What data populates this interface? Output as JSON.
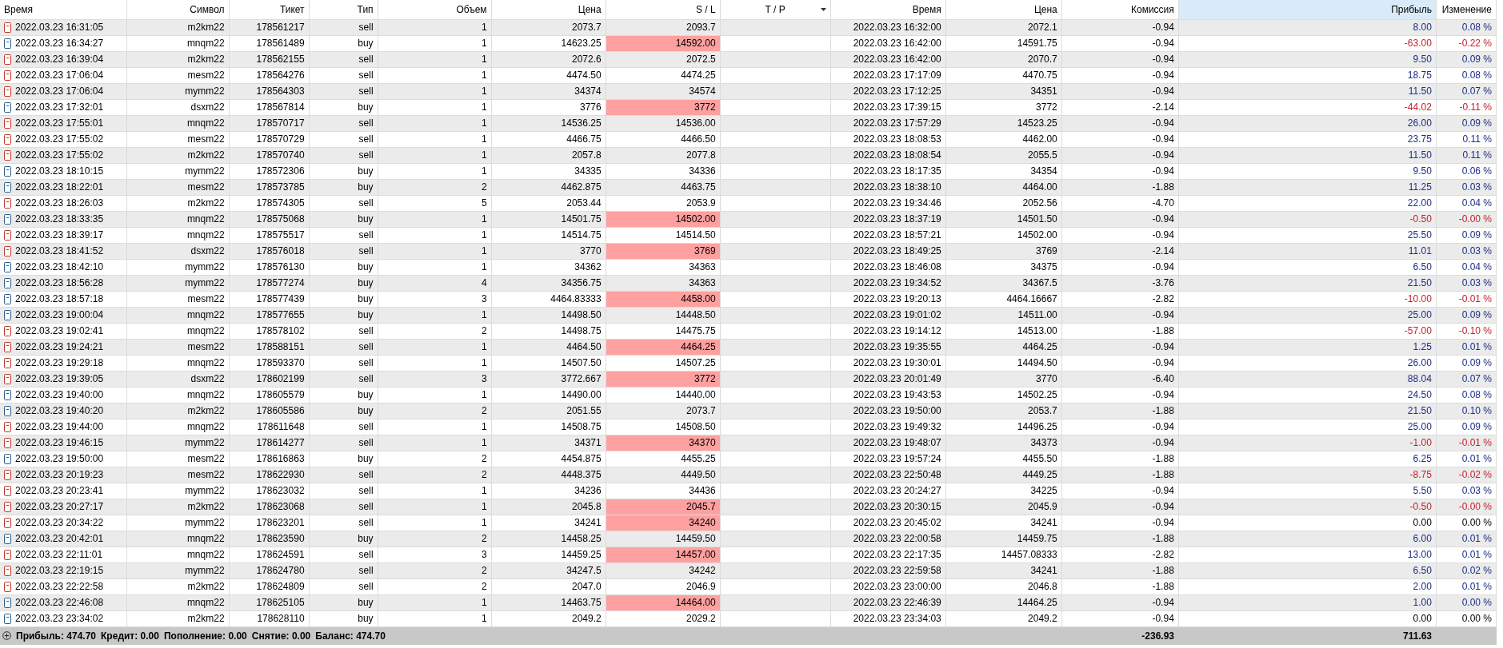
{
  "columns": [
    {
      "label": "Время",
      "highlighted": false,
      "sorted": false
    },
    {
      "label": "Символ",
      "highlighted": false,
      "sorted": false
    },
    {
      "label": "Тикет",
      "highlighted": false,
      "sorted": false
    },
    {
      "label": "Тип",
      "highlighted": false,
      "sorted": false
    },
    {
      "label": "Объем",
      "highlighted": false,
      "sorted": false
    },
    {
      "label": "Цена",
      "highlighted": false,
      "sorted": false
    },
    {
      "label": "S / L",
      "highlighted": false,
      "sorted": false
    },
    {
      "label": "T / P",
      "highlighted": false,
      "sorted": true
    },
    {
      "label": "Время",
      "highlighted": false,
      "sorted": false
    },
    {
      "label": "Цена",
      "highlighted": false,
      "sorted": false
    },
    {
      "label": "Комиссия",
      "highlighted": false,
      "sorted": false
    },
    {
      "label": "Прибыль",
      "highlighted": true,
      "sorted": false
    },
    {
      "label": "Изменение",
      "highlighted": false,
      "sorted": false
    }
  ],
  "rows": [
    {
      "kind": "sell",
      "open_time": "2022.03.23 16:31:05",
      "symbol": "m2km22",
      "ticket": "178561217",
      "type": "sell",
      "volume": "1",
      "price": "2073.7",
      "sl": "2093.7",
      "sl_hit": false,
      "close_time": "2022.03.23 16:32:00",
      "close_price": "2072.1",
      "commission": "-0.94",
      "profit": "8.00",
      "change": "0.08 %",
      "color": "#1a2f8a"
    },
    {
      "kind": "buy",
      "open_time": "2022.03.23 16:34:27",
      "symbol": "mnqm22",
      "ticket": "178561489",
      "type": "buy",
      "volume": "1",
      "price": "14623.25",
      "sl": "14592.00",
      "sl_hit": true,
      "close_time": "2022.03.23 16:42:00",
      "close_price": "14591.75",
      "commission": "-0.94",
      "profit": "-63.00",
      "change": "-0.22 %",
      "color": "#c8202a"
    },
    {
      "kind": "sell",
      "open_time": "2022.03.23 16:39:04",
      "symbol": "m2km22",
      "ticket": "178562155",
      "type": "sell",
      "volume": "1",
      "price": "2072.6",
      "sl": "2072.5",
      "sl_hit": false,
      "close_time": "2022.03.23 16:42:00",
      "close_price": "2070.7",
      "commission": "-0.94",
      "profit": "9.50",
      "change": "0.09 %",
      "color": "#1a2f8a"
    },
    {
      "kind": "sell",
      "open_time": "2022.03.23 17:06:04",
      "symbol": "mesm22",
      "ticket": "178564276",
      "type": "sell",
      "volume": "1",
      "price": "4474.50",
      "sl": "4474.25",
      "sl_hit": false,
      "close_time": "2022.03.23 17:17:09",
      "close_price": "4470.75",
      "commission": "-0.94",
      "profit": "18.75",
      "change": "0.08 %",
      "color": "#1a2f8a"
    },
    {
      "kind": "sell",
      "open_time": "2022.03.23 17:06:04",
      "symbol": "mymm22",
      "ticket": "178564303",
      "type": "sell",
      "volume": "1",
      "price": "34374",
      "sl": "34574",
      "sl_hit": false,
      "close_time": "2022.03.23 17:12:25",
      "close_price": "34351",
      "commission": "-0.94",
      "profit": "11.50",
      "change": "0.07 %",
      "color": "#1a2f8a"
    },
    {
      "kind": "buy",
      "open_time": "2022.03.23 17:32:01",
      "symbol": "dsxm22",
      "ticket": "178567814",
      "type": "buy",
      "volume": "1",
      "price": "3776",
      "sl": "3772",
      "sl_hit": true,
      "close_time": "2022.03.23 17:39:15",
      "close_price": "3772",
      "commission": "-2.14",
      "profit": "-44.02",
      "change": "-0.11 %",
      "color": "#c8202a"
    },
    {
      "kind": "sell",
      "open_time": "2022.03.23 17:55:01",
      "symbol": "mnqm22",
      "ticket": "178570717",
      "type": "sell",
      "volume": "1",
      "price": "14536.25",
      "sl": "14536.00",
      "sl_hit": false,
      "close_time": "2022.03.23 17:57:29",
      "close_price": "14523.25",
      "commission": "-0.94",
      "profit": "26.00",
      "change": "0.09 %",
      "color": "#1a2f8a"
    },
    {
      "kind": "sell",
      "open_time": "2022.03.23 17:55:02",
      "symbol": "mesm22",
      "ticket": "178570729",
      "type": "sell",
      "volume": "1",
      "price": "4466.75",
      "sl": "4466.50",
      "sl_hit": false,
      "close_time": "2022.03.23 18:08:53",
      "close_price": "4462.00",
      "commission": "-0.94",
      "profit": "23.75",
      "change": "0.11 %",
      "color": "#1a2f8a"
    },
    {
      "kind": "sell",
      "open_time": "2022.03.23 17:55:02",
      "symbol": "m2km22",
      "ticket": "178570740",
      "type": "sell",
      "volume": "1",
      "price": "2057.8",
      "sl": "2077.8",
      "sl_hit": false,
      "close_time": "2022.03.23 18:08:54",
      "close_price": "2055.5",
      "commission": "-0.94",
      "profit": "11.50",
      "change": "0.11 %",
      "color": "#1a2f8a"
    },
    {
      "kind": "buy",
      "open_time": "2022.03.23 18:10:15",
      "symbol": "mymm22",
      "ticket": "178572306",
      "type": "buy",
      "volume": "1",
      "price": "34335",
      "sl": "34336",
      "sl_hit": false,
      "close_time": "2022.03.23 18:17:35",
      "close_price": "34354",
      "commission": "-0.94",
      "profit": "9.50",
      "change": "0.06 %",
      "color": "#1a2f8a"
    },
    {
      "kind": "buy",
      "open_time": "2022.03.23 18:22:01",
      "symbol": "mesm22",
      "ticket": "178573785",
      "type": "buy",
      "volume": "2",
      "price": "4462.875",
      "sl": "4463.75",
      "sl_hit": false,
      "close_time": "2022.03.23 18:38:10",
      "close_price": "4464.00",
      "commission": "-1.88",
      "profit": "11.25",
      "change": "0.03 %",
      "color": "#1a2f8a"
    },
    {
      "kind": "sell",
      "open_time": "2022.03.23 18:26:03",
      "symbol": "m2km22",
      "ticket": "178574305",
      "type": "sell",
      "volume": "5",
      "price": "2053.44",
      "sl": "2053.9",
      "sl_hit": false,
      "close_time": "2022.03.23 19:34:46",
      "close_price": "2052.56",
      "commission": "-4.70",
      "profit": "22.00",
      "change": "0.04 %",
      "color": "#1a2f8a"
    },
    {
      "kind": "buy",
      "open_time": "2022.03.23 18:33:35",
      "symbol": "mnqm22",
      "ticket": "178575068",
      "type": "buy",
      "volume": "1",
      "price": "14501.75",
      "sl": "14502.00",
      "sl_hit": true,
      "close_time": "2022.03.23 18:37:19",
      "close_price": "14501.50",
      "commission": "-0.94",
      "profit": "-0.50",
      "change": "-0.00 %",
      "color": "#c8202a"
    },
    {
      "kind": "sell",
      "open_time": "2022.03.23 18:39:17",
      "symbol": "mnqm22",
      "ticket": "178575517",
      "type": "sell",
      "volume": "1",
      "price": "14514.75",
      "sl": "14514.50",
      "sl_hit": false,
      "close_time": "2022.03.23 18:57:21",
      "close_price": "14502.00",
      "commission": "-0.94",
      "profit": "25.50",
      "change": "0.09 %",
      "color": "#1a2f8a"
    },
    {
      "kind": "sell",
      "open_time": "2022.03.23 18:41:52",
      "symbol": "dsxm22",
      "ticket": "178576018",
      "type": "sell",
      "volume": "1",
      "price": "3770",
      "sl": "3769",
      "sl_hit": true,
      "close_time": "2022.03.23 18:49:25",
      "close_price": "3769",
      "commission": "-2.14",
      "profit": "11.01",
      "change": "0.03 %",
      "color": "#1a2f8a"
    },
    {
      "kind": "buy",
      "open_time": "2022.03.23 18:42:10",
      "symbol": "mymm22",
      "ticket": "178576130",
      "type": "buy",
      "volume": "1",
      "price": "34362",
      "sl": "34363",
      "sl_hit": false,
      "close_time": "2022.03.23 18:46:08",
      "close_price": "34375",
      "commission": "-0.94",
      "profit": "6.50",
      "change": "0.04 %",
      "color": "#1a2f8a"
    },
    {
      "kind": "buy",
      "open_time": "2022.03.23 18:56:28",
      "symbol": "mymm22",
      "ticket": "178577274",
      "type": "buy",
      "volume": "4",
      "price": "34356.75",
      "sl": "34363",
      "sl_hit": false,
      "close_time": "2022.03.23 19:34:52",
      "close_price": "34367.5",
      "commission": "-3.76",
      "profit": "21.50",
      "change": "0.03 %",
      "color": "#1a2f8a"
    },
    {
      "kind": "buy",
      "open_time": "2022.03.23 18:57:18",
      "symbol": "mesm22",
      "ticket": "178577439",
      "type": "buy",
      "volume": "3",
      "price": "4464.83333",
      "sl": "4458.00",
      "sl_hit": true,
      "close_time": "2022.03.23 19:20:13",
      "close_price": "4464.16667",
      "commission": "-2.82",
      "profit": "-10.00",
      "change": "-0.01 %",
      "color": "#c8202a"
    },
    {
      "kind": "buy",
      "open_time": "2022.03.23 19:00:04",
      "symbol": "mnqm22",
      "ticket": "178577655",
      "type": "buy",
      "volume": "1",
      "price": "14498.50",
      "sl": "14448.50",
      "sl_hit": false,
      "close_time": "2022.03.23 19:01:02",
      "close_price": "14511.00",
      "commission": "-0.94",
      "profit": "25.00",
      "change": "0.09 %",
      "color": "#1a2f8a"
    },
    {
      "kind": "sell",
      "open_time": "2022.03.23 19:02:41",
      "symbol": "mnqm22",
      "ticket": "178578102",
      "type": "sell",
      "volume": "2",
      "price": "14498.75",
      "sl": "14475.75",
      "sl_hit": false,
      "close_time": "2022.03.23 19:14:12",
      "close_price": "14513.00",
      "commission": "-1.88",
      "profit": "-57.00",
      "change": "-0.10 %",
      "color": "#c8202a"
    },
    {
      "kind": "sell",
      "open_time": "2022.03.23 19:24:21",
      "symbol": "mesm22",
      "ticket": "178588151",
      "type": "sell",
      "volume": "1",
      "price": "4464.50",
      "sl": "4464.25",
      "sl_hit": true,
      "close_time": "2022.03.23 19:35:55",
      "close_price": "4464.25",
      "commission": "-0.94",
      "profit": "1.25",
      "change": "0.01 %",
      "color": "#1a2f8a"
    },
    {
      "kind": "sell",
      "open_time": "2022.03.23 19:29:18",
      "symbol": "mnqm22",
      "ticket": "178593370",
      "type": "sell",
      "volume": "1",
      "price": "14507.50",
      "sl": "14507.25",
      "sl_hit": false,
      "close_time": "2022.03.23 19:30:01",
      "close_price": "14494.50",
      "commission": "-0.94",
      "profit": "26.00",
      "change": "0.09 %",
      "color": "#1a2f8a"
    },
    {
      "kind": "sell",
      "open_time": "2022.03.23 19:39:05",
      "symbol": "dsxm22",
      "ticket": "178602199",
      "type": "sell",
      "volume": "3",
      "price": "3772.667",
      "sl": "3772",
      "sl_hit": true,
      "close_time": "2022.03.23 20:01:49",
      "close_price": "3770",
      "commission": "-6.40",
      "profit": "88.04",
      "change": "0.07 %",
      "color": "#1a2f8a"
    },
    {
      "kind": "buy",
      "open_time": "2022.03.23 19:40:00",
      "symbol": "mnqm22",
      "ticket": "178605579",
      "type": "buy",
      "volume": "1",
      "price": "14490.00",
      "sl": "14440.00",
      "sl_hit": false,
      "close_time": "2022.03.23 19:43:53",
      "close_price": "14502.25",
      "commission": "-0.94",
      "profit": "24.50",
      "change": "0.08 %",
      "color": "#1a2f8a"
    },
    {
      "kind": "buy",
      "open_time": "2022.03.23 19:40:20",
      "symbol": "m2km22",
      "ticket": "178605586",
      "type": "buy",
      "volume": "2",
      "price": "2051.55",
      "sl": "2073.7",
      "sl_hit": false,
      "close_time": "2022.03.23 19:50:00",
      "close_price": "2053.7",
      "commission": "-1.88",
      "profit": "21.50",
      "change": "0.10 %",
      "color": "#1a2f8a"
    },
    {
      "kind": "sell",
      "open_time": "2022.03.23 19:44:00",
      "symbol": "mnqm22",
      "ticket": "178611648",
      "type": "sell",
      "volume": "1",
      "price": "14508.75",
      "sl": "14508.50",
      "sl_hit": false,
      "close_time": "2022.03.23 19:49:32",
      "close_price": "14496.25",
      "commission": "-0.94",
      "profit": "25.00",
      "change": "0.09 %",
      "color": "#1a2f8a"
    },
    {
      "kind": "sell",
      "open_time": "2022.03.23 19:46:15",
      "symbol": "mymm22",
      "ticket": "178614277",
      "type": "sell",
      "volume": "1",
      "price": "34371",
      "sl": "34370",
      "sl_hit": true,
      "close_time": "2022.03.23 19:48:07",
      "close_price": "34373",
      "commission": "-0.94",
      "profit": "-1.00",
      "change": "-0.01 %",
      "color": "#c8202a"
    },
    {
      "kind": "buy",
      "open_time": "2022.03.23 19:50:00",
      "symbol": "mesm22",
      "ticket": "178616863",
      "type": "buy",
      "volume": "2",
      "price": "4454.875",
      "sl": "4455.25",
      "sl_hit": false,
      "close_time": "2022.03.23 19:57:24",
      "close_price": "4455.50",
      "commission": "-1.88",
      "profit": "6.25",
      "change": "0.01 %",
      "color": "#1a2f8a"
    },
    {
      "kind": "sell",
      "open_time": "2022.03.23 20:19:23",
      "symbol": "mesm22",
      "ticket": "178622930",
      "type": "sell",
      "volume": "2",
      "price": "4448.375",
      "sl": "4449.50",
      "sl_hit": false,
      "close_time": "2022.03.23 22:50:48",
      "close_price": "4449.25",
      "commission": "-1.88",
      "profit": "-8.75",
      "change": "-0.02 %",
      "color": "#c8202a"
    },
    {
      "kind": "sell",
      "open_time": "2022.03.23 20:23:41",
      "symbol": "mymm22",
      "ticket": "178623032",
      "type": "sell",
      "volume": "1",
      "price": "34236",
      "sl": "34436",
      "sl_hit": false,
      "close_time": "2022.03.23 20:24:27",
      "close_price": "34225",
      "commission": "-0.94",
      "profit": "5.50",
      "change": "0.03 %",
      "color": "#1a2f8a"
    },
    {
      "kind": "sell",
      "open_time": "2022.03.23 20:27:17",
      "symbol": "m2km22",
      "ticket": "178623068",
      "type": "sell",
      "volume": "1",
      "price": "2045.8",
      "sl": "2045.7",
      "sl_hit": true,
      "close_time": "2022.03.23 20:30:15",
      "close_price": "2045.9",
      "commission": "-0.94",
      "profit": "-0.50",
      "change": "-0.00 %",
      "color": "#c8202a"
    },
    {
      "kind": "sell",
      "open_time": "2022.03.23 20:34:22",
      "symbol": "mymm22",
      "ticket": "178623201",
      "type": "sell",
      "volume": "1",
      "price": "34241",
      "sl": "34240",
      "sl_hit": true,
      "close_time": "2022.03.23 20:45:02",
      "close_price": "34241",
      "commission": "-0.94",
      "profit": "0.00",
      "change": "0.00 %",
      "color": "#000000"
    },
    {
      "kind": "buy",
      "open_time": "2022.03.23 20:42:01",
      "symbol": "mnqm22",
      "ticket": "178623590",
      "type": "buy",
      "volume": "2",
      "price": "14458.25",
      "sl": "14459.50",
      "sl_hit": false,
      "close_time": "2022.03.23 22:00:58",
      "close_price": "14459.75",
      "commission": "-1.88",
      "profit": "6.00",
      "change": "0.01 %",
      "color": "#1a2f8a"
    },
    {
      "kind": "sell",
      "open_time": "2022.03.23 22:11:01",
      "symbol": "mnqm22",
      "ticket": "178624591",
      "type": "sell",
      "volume": "3",
      "price": "14459.25",
      "sl": "14457.00",
      "sl_hit": true,
      "close_time": "2022.03.23 22:17:35",
      "close_price": "14457.08333",
      "commission": "-2.82",
      "profit": "13.00",
      "change": "0.01 %",
      "color": "#1a2f8a"
    },
    {
      "kind": "sell",
      "open_time": "2022.03.23 22:19:15",
      "symbol": "mymm22",
      "ticket": "178624780",
      "type": "sell",
      "volume": "2",
      "price": "34247.5",
      "sl": "34242",
      "sl_hit": false,
      "close_time": "2022.03.23 22:59:58",
      "close_price": "34241",
      "commission": "-1.88",
      "profit": "6.50",
      "change": "0.02 %",
      "color": "#1a2f8a"
    },
    {
      "kind": "sell",
      "open_time": "2022.03.23 22:22:58",
      "symbol": "m2km22",
      "ticket": "178624809",
      "type": "sell",
      "volume": "2",
      "price": "2047.0",
      "sl": "2046.9",
      "sl_hit": false,
      "close_time": "2022.03.23 23:00:00",
      "close_price": "2046.8",
      "commission": "-1.88",
      "profit": "2.00",
      "change": "0.01 %",
      "color": "#1a2f8a"
    },
    {
      "kind": "buy",
      "open_time": "2022.03.23 22:46:08",
      "symbol": "mnqm22",
      "ticket": "178625105",
      "type": "buy",
      "volume": "1",
      "price": "14463.75",
      "sl": "14464.00",
      "sl_hit": true,
      "close_time": "2022.03.23 22:46:39",
      "close_price": "14464.25",
      "commission": "-0.94",
      "profit": "1.00",
      "change": "0.00 %",
      "color": "#1a2f8a"
    },
    {
      "kind": "buy",
      "open_time": "2022.03.23 23:34:02",
      "symbol": "m2km22",
      "ticket": "178628110",
      "type": "buy",
      "volume": "1",
      "price": "2049.2",
      "sl": "2029.2",
      "sl_hit": false,
      "close_time": "2022.03.23 23:34:03",
      "close_price": "2049.2",
      "commission": "-0.94",
      "profit": "0.00",
      "change": "0.00 %",
      "color": "#000000"
    }
  ],
  "summary": [
    {
      "label": "Прибыль:",
      "value": "474.70"
    },
    {
      "label": "Кредит:",
      "value": "0.00"
    },
    {
      "label": "Пополнение:",
      "value": "0.00"
    },
    {
      "label": "Снятие:",
      "value": "0.00"
    },
    {
      "label": "Баланс:",
      "value": "474.70"
    }
  ],
  "totals": {
    "commission": "-236.93",
    "profit": "711.63"
  }
}
